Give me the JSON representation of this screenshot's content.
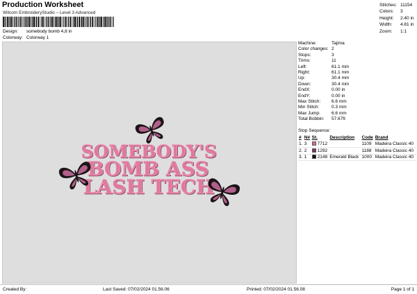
{
  "header": {
    "title": "Production Worksheet",
    "software": "Wilcom EmbroideryStudio – Level 3 Advanced",
    "design_label": "Design:",
    "design_value": "somebody  bomb 4,8 in",
    "colorway_label": "Colorway:",
    "colorway_value": "Colorway 1"
  },
  "stats": [
    {
      "label": "Stitches:",
      "value": "11154"
    },
    {
      "label": "Colors:",
      "value": "3"
    },
    {
      "label": "Height:",
      "value": "2.40 in"
    },
    {
      "label": "Width:",
      "value": "4.81 in"
    },
    {
      "label": "Zoom:",
      "value": "1:1"
    }
  ],
  "machine_info": [
    {
      "label": "Machine:",
      "value": "Tajima"
    },
    {
      "label": "Color changes:",
      "value": "2"
    },
    {
      "label": "Stops:",
      "value": "3"
    },
    {
      "label": "Trims:",
      "value": "11"
    },
    {
      "label": "Left:",
      "value": "61.1 mm"
    },
    {
      "label": "Right:",
      "value": "61.1 mm"
    },
    {
      "label": "Up:",
      "value": "30.4 mm"
    },
    {
      "label": "Down:",
      "value": "30.4 mm"
    },
    {
      "label": "EndX:",
      "value": "0.00 in"
    },
    {
      "label": "EndY:",
      "value": "0.00 in"
    },
    {
      "label": "Max Stitch:",
      "value": "6.6 mm"
    },
    {
      "label": "Min Stitch:",
      "value": "0.3 mm"
    },
    {
      "label": "Max Jump:",
      "value": "6.6 mm"
    },
    {
      "label": "Total Bobbin:",
      "value": "57.67ft"
    }
  ],
  "stop_sequence": {
    "title": "Stop Sequence:",
    "columns": [
      "#",
      "N#",
      "St.",
      "Description",
      "Code",
      "Brand"
    ],
    "rows": [
      {
        "num": "1.",
        "needle": "3",
        "color": "#d96a92",
        "stitches": "7712",
        "description": "",
        "code": "1109",
        "brand": "Madeira Classic 40"
      },
      {
        "num": "2.",
        "needle": "2",
        "color": "#7a3560",
        "stitches": "1292",
        "description": "",
        "code": "1188",
        "brand": "Madeira Classic 40"
      },
      {
        "num": "3.",
        "needle": "1",
        "color": "#111111",
        "stitches": "2148",
        "description": "Emerald Black",
        "code": "1000",
        "brand": "Madeira Classic 40"
      }
    ]
  },
  "design_text": {
    "line1": "SOMEBODY'S",
    "line2": "BOMB ASS",
    "line3": "LASH TECH"
  },
  "colors": {
    "text_pink": "#e0789d",
    "text_shadow": "#8a3f62",
    "butterfly_dark": "#1c1418",
    "butterfly_pink": "#b0608a",
    "preview_bg": "#dedede"
  },
  "footer": {
    "created_by": "Created By:",
    "last_saved": "Last Saved: 07/02/2024 01.56.06",
    "printed": "Printed: 07/02/2024 01.56.08",
    "page": "Page 1 of 1"
  }
}
